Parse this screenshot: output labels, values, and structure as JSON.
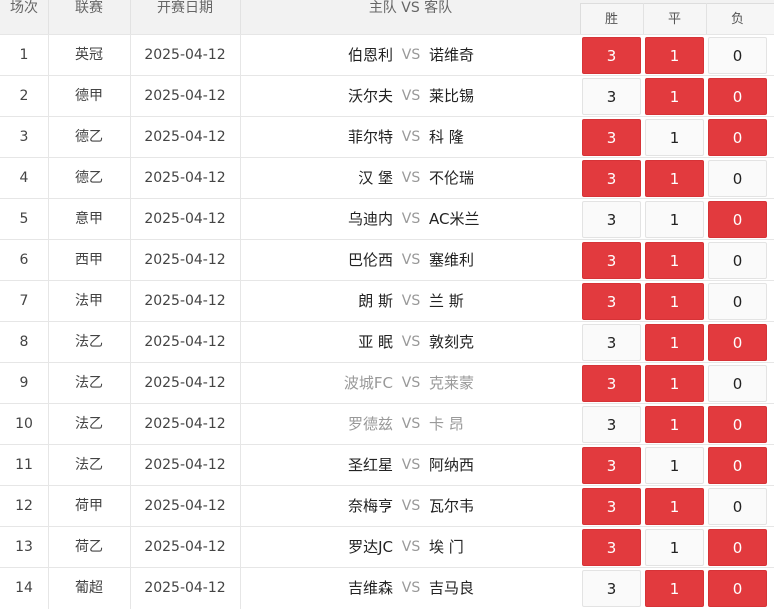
{
  "header": {
    "col_round": "场次",
    "col_league": "联赛",
    "col_date": "开赛日期",
    "col_teams": "主队 VS 客队",
    "col_win": "胜",
    "col_draw": "平",
    "col_loss": "负"
  },
  "vs_label": "VS",
  "rows": [
    {
      "no": "1",
      "league": "英冠",
      "date": "2025-04-12",
      "home": "伯恩利",
      "away": "诺维奇",
      "faded": false,
      "odds": [
        "3",
        "1",
        "0"
      ],
      "sel": [
        true,
        true,
        false
      ]
    },
    {
      "no": "2",
      "league": "德甲",
      "date": "2025-04-12",
      "home": "沃尔夫",
      "away": "莱比锡",
      "faded": false,
      "odds": [
        "3",
        "1",
        "0"
      ],
      "sel": [
        false,
        true,
        true
      ]
    },
    {
      "no": "3",
      "league": "德乙",
      "date": "2025-04-12",
      "home": "菲尔特",
      "away": "科 隆",
      "faded": false,
      "odds": [
        "3",
        "1",
        "0"
      ],
      "sel": [
        true,
        false,
        true
      ]
    },
    {
      "no": "4",
      "league": "德乙",
      "date": "2025-04-12",
      "home": "汉 堡",
      "away": "不伦瑞",
      "faded": false,
      "odds": [
        "3",
        "1",
        "0"
      ],
      "sel": [
        true,
        true,
        false
      ]
    },
    {
      "no": "5",
      "league": "意甲",
      "date": "2025-04-12",
      "home": "乌迪内",
      "away": "AC米兰",
      "faded": false,
      "odds": [
        "3",
        "1",
        "0"
      ],
      "sel": [
        false,
        false,
        true
      ]
    },
    {
      "no": "6",
      "league": "西甲",
      "date": "2025-04-12",
      "home": "巴伦西",
      "away": "塞维利",
      "faded": false,
      "odds": [
        "3",
        "1",
        "0"
      ],
      "sel": [
        true,
        true,
        false
      ]
    },
    {
      "no": "7",
      "league": "法甲",
      "date": "2025-04-12",
      "home": "朗 斯",
      "away": "兰 斯",
      "faded": false,
      "odds": [
        "3",
        "1",
        "0"
      ],
      "sel": [
        true,
        true,
        false
      ]
    },
    {
      "no": "8",
      "league": "法乙",
      "date": "2025-04-12",
      "home": "亚 眠",
      "away": "敦刻克",
      "faded": false,
      "odds": [
        "3",
        "1",
        "0"
      ],
      "sel": [
        false,
        true,
        true
      ]
    },
    {
      "no": "9",
      "league": "法乙",
      "date": "2025-04-12",
      "home": "波城FC",
      "away": "克莱蒙",
      "faded": true,
      "odds": [
        "3",
        "1",
        "0"
      ],
      "sel": [
        true,
        true,
        false
      ]
    },
    {
      "no": "10",
      "league": "法乙",
      "date": "2025-04-12",
      "home": "罗德兹",
      "away": "卡 昂",
      "faded": true,
      "odds": [
        "3",
        "1",
        "0"
      ],
      "sel": [
        false,
        true,
        true
      ]
    },
    {
      "no": "11",
      "league": "法乙",
      "date": "2025-04-12",
      "home": "圣红星",
      "away": "阿纳西",
      "faded": false,
      "odds": [
        "3",
        "1",
        "0"
      ],
      "sel": [
        true,
        false,
        true
      ]
    },
    {
      "no": "12",
      "league": "荷甲",
      "date": "2025-04-12",
      "home": "奈梅亨",
      "away": "瓦尔韦",
      "faded": false,
      "odds": [
        "3",
        "1",
        "0"
      ],
      "sel": [
        true,
        true,
        false
      ]
    },
    {
      "no": "13",
      "league": "荷乙",
      "date": "2025-04-12",
      "home": "罗达JC",
      "away": "埃 门",
      "faded": false,
      "odds": [
        "3",
        "1",
        "0"
      ],
      "sel": [
        true,
        false,
        true
      ]
    },
    {
      "no": "14",
      "league": "葡超",
      "date": "2025-04-12",
      "home": "吉维森",
      "away": "吉马良",
      "faded": false,
      "odds": [
        "3",
        "1",
        "0"
      ],
      "sel": [
        false,
        true,
        true
      ]
    }
  ],
  "colors": {
    "selected": "#e23a3e",
    "unselected": "#fafafa"
  }
}
